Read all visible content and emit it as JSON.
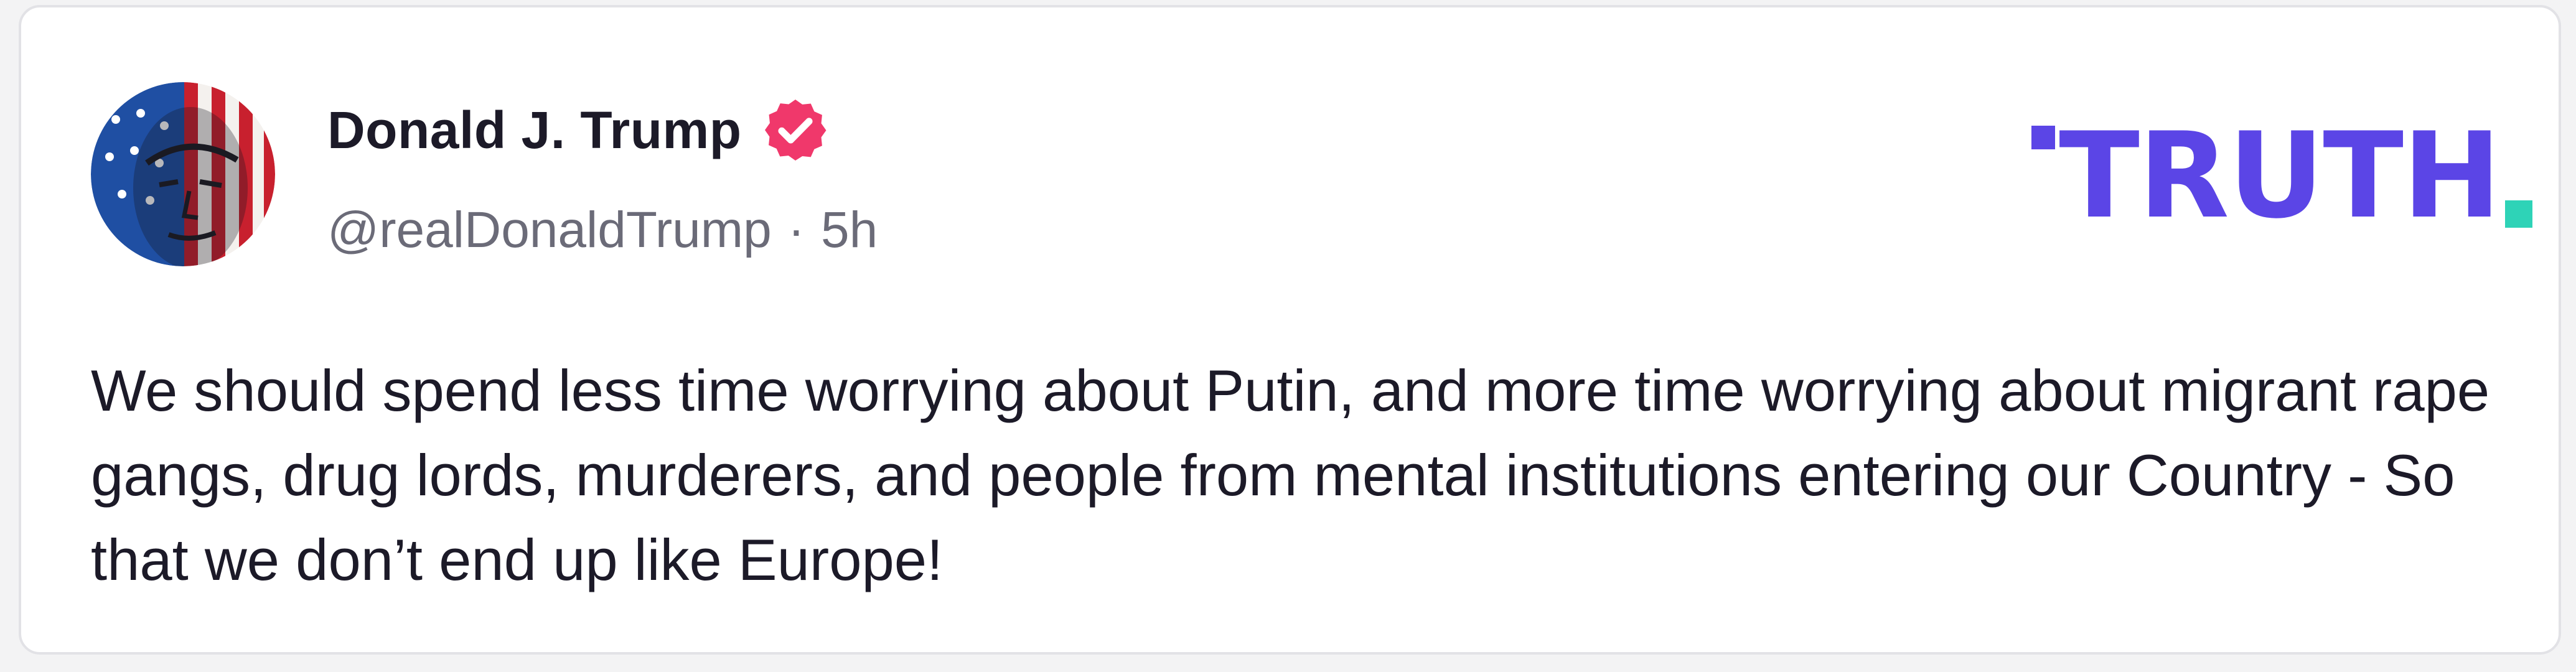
{
  "post": {
    "author": {
      "display_name": "Donald J. Trump",
      "handle": "@realDonaldTrump",
      "verified": true,
      "avatar_icon": "flag-portrait-avatar"
    },
    "time_separator": "·",
    "timestamp": "5h",
    "text": "We should spend less time worrying about Putin, and more time worrying about migrant rape gangs, drug lords, murderers, and people from mental institutions entering our Country - So that we don’t end up like Europe!"
  },
  "brand": {
    "logo_text": "TRUTH",
    "logo_icon": "truth-social-logo",
    "colors": {
      "primary": "#5b45e6",
      "accent": "#2ed3b7",
      "verified_badge": "#f0386b"
    }
  }
}
